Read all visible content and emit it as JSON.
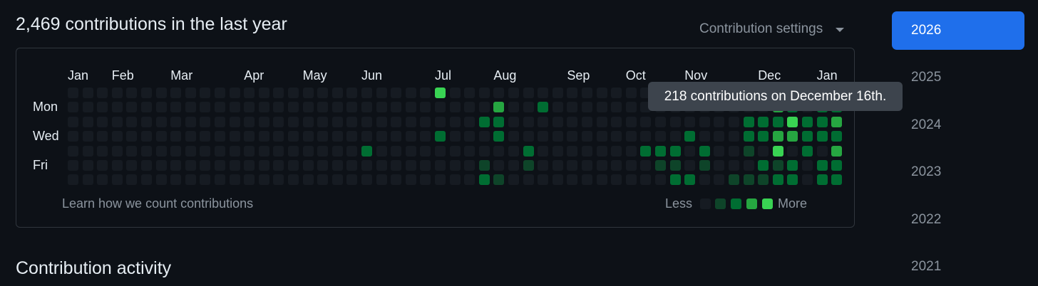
{
  "contributions": {
    "heading": "2,469 contributions in the last year",
    "settings_label": "Contribution settings",
    "months": [
      {
        "label": "Jan",
        "week": 0
      },
      {
        "label": "Feb",
        "week": 3
      },
      {
        "label": "Mar",
        "week": 7
      },
      {
        "label": "Apr",
        "week": 12
      },
      {
        "label": "May",
        "week": 16
      },
      {
        "label": "Jun",
        "week": 20
      },
      {
        "label": "Jul",
        "week": 25
      },
      {
        "label": "Aug",
        "week": 29
      },
      {
        "label": "Sep",
        "week": 34
      },
      {
        "label": "Oct",
        "week": 38
      },
      {
        "label": "Nov",
        "week": 42
      },
      {
        "label": "Dec",
        "week": 47
      },
      {
        "label": "Jan",
        "week": 51
      }
    ],
    "day_labels": [
      {
        "label": "Mon",
        "row": 1
      },
      {
        "label": "Wed",
        "row": 3
      },
      {
        "label": "Fri",
        "row": 5
      }
    ],
    "weeks": 53,
    "levels": [
      [
        25,
        0,
        4
      ],
      [
        29,
        1,
        3
      ],
      [
        29,
        2,
        2
      ],
      [
        29,
        3,
        2
      ],
      [
        29,
        6,
        1
      ],
      [
        28,
        2,
        2
      ],
      [
        28,
        6,
        2
      ],
      [
        28,
        5,
        1
      ],
      [
        31,
        4,
        2
      ],
      [
        31,
        5,
        1
      ],
      [
        32,
        1,
        2
      ],
      [
        20,
        4,
        2
      ],
      [
        25,
        3,
        2
      ],
      [
        39,
        4,
        2
      ],
      [
        40,
        4,
        2
      ],
      [
        40,
        5,
        1
      ],
      [
        41,
        4,
        2
      ],
      [
        41,
        6,
        2
      ],
      [
        41,
        5,
        1
      ],
      [
        42,
        3,
        2
      ],
      [
        42,
        6,
        2
      ],
      [
        43,
        4,
        2
      ],
      [
        43,
        5,
        1
      ],
      [
        45,
        6,
        1
      ],
      [
        46,
        2,
        2
      ],
      [
        46,
        3,
        2
      ],
      [
        46,
        4,
        1
      ],
      [
        46,
        6,
        1
      ],
      [
        47,
        2,
        2
      ],
      [
        47,
        3,
        2
      ],
      [
        47,
        5,
        2
      ],
      [
        47,
        6,
        1
      ],
      [
        48,
        1,
        3
      ],
      [
        48,
        2,
        2
      ],
      [
        48,
        3,
        3
      ],
      [
        48,
        4,
        4
      ],
      [
        48,
        5,
        1
      ],
      [
        48,
        6,
        2
      ],
      [
        49,
        1,
        2
      ],
      [
        49,
        2,
        4
      ],
      [
        49,
        3,
        3
      ],
      [
        49,
        5,
        2
      ],
      [
        49,
        6,
        2
      ],
      [
        50,
        2,
        2
      ],
      [
        50,
        3,
        2
      ],
      [
        50,
        4,
        2
      ],
      [
        51,
        1,
        2
      ],
      [
        51,
        2,
        2
      ],
      [
        51,
        3,
        2
      ],
      [
        51,
        5,
        2
      ],
      [
        51,
        6,
        2
      ],
      [
        52,
        1,
        2
      ],
      [
        52,
        2,
        3
      ],
      [
        52,
        3,
        2
      ],
      [
        52,
        4,
        3
      ],
      [
        52,
        5,
        2
      ],
      [
        52,
        6,
        2
      ],
      [
        53,
        1,
        2
      ],
      [
        53,
        2,
        2
      ]
    ],
    "level_colors": [
      "#161b22",
      "#0e4429",
      "#006d32",
      "#26a641",
      "#39d353"
    ],
    "learn_link": "Learn how we count contributions",
    "legend_less": "Less",
    "legend_more": "More",
    "tooltip": "218 contributions on December 16th."
  },
  "activity_heading": "Contribution activity",
  "years": [
    "2026",
    "2025",
    "2024",
    "2023",
    "2022",
    "2021"
  ],
  "selected_year": "2026",
  "colors": {
    "accent": "#1f6feb",
    "background": "#0d1117"
  }
}
